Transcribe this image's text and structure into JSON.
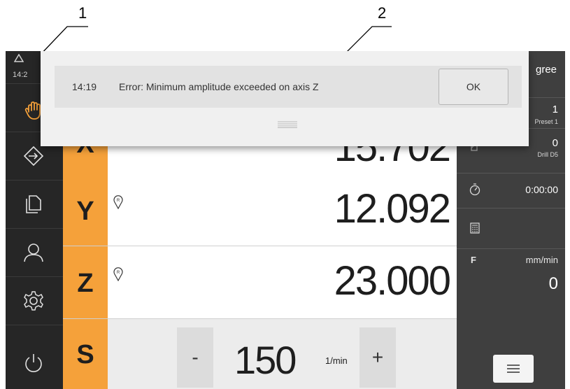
{
  "callouts": [
    "1",
    "2"
  ],
  "sidebar": {
    "status_icon": "warning-triangle-icon",
    "time": "14:2",
    "items": [
      {
        "name": "manual-mode",
        "icon": "hand-icon"
      },
      {
        "name": "login",
        "icon": "arrow-right-in-icon"
      },
      {
        "name": "file-management",
        "icon": "documents-icon"
      },
      {
        "name": "user",
        "icon": "user-icon"
      },
      {
        "name": "settings",
        "icon": "gear-icon"
      },
      {
        "name": "power",
        "icon": "power-icon"
      }
    ]
  },
  "axes": [
    {
      "axis": "X",
      "value": "15.702"
    },
    {
      "axis": "Y",
      "value": "12.092"
    },
    {
      "axis": "Z",
      "value": "23.000"
    }
  ],
  "spindle": {
    "axis": "S",
    "minus_label": "-",
    "value": "150",
    "unit": "1/min",
    "plus_label": "+"
  },
  "right_panel": {
    "header_title": "gree",
    "preset": {
      "value": "1",
      "label": "Preset 1"
    },
    "tool": {
      "value": "0",
      "label": "Drill D5"
    },
    "timer": {
      "value": "0:00:00"
    },
    "feed": {
      "label": "F",
      "unit": "mm/min",
      "value": "0"
    }
  },
  "dialog": {
    "time": "14:19",
    "message": "Error: Minimum amplitude exceeded on axis Z",
    "ok_label": "OK"
  },
  "colors": {
    "accent": "#f5a13a",
    "sidebar": "#262626",
    "panel": "#3f3f3f"
  }
}
